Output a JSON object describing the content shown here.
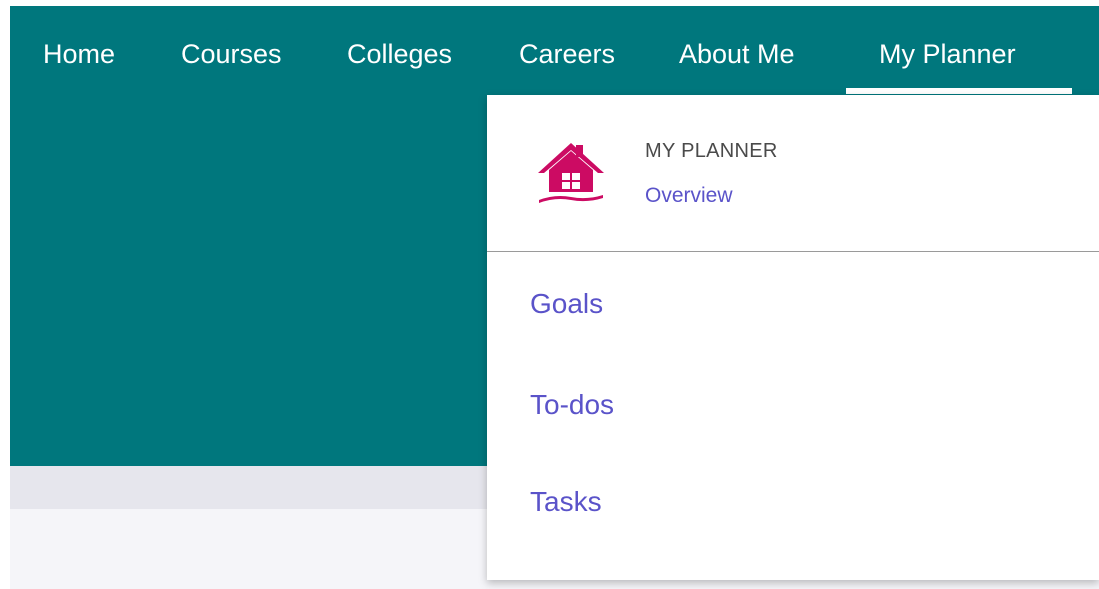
{
  "nav": {
    "items": [
      {
        "label": "Home"
      },
      {
        "label": "Courses"
      },
      {
        "label": "Colleges"
      },
      {
        "label": "Careers"
      },
      {
        "label": "About Me"
      },
      {
        "label": "My Planner"
      }
    ],
    "active": "My Planner"
  },
  "dropdown": {
    "title": "MY PLANNER",
    "overview_label": "Overview",
    "icon": "house-icon",
    "links": [
      {
        "label": "Goals"
      },
      {
        "label": "To-dos"
      },
      {
        "label": "Tasks"
      }
    ]
  },
  "colors": {
    "header_bg": "#00777d",
    "link": "#5a53c9",
    "icon": "#cc0b63",
    "band_gray": "#e6e6ed",
    "band_light": "#f5f5f9"
  }
}
